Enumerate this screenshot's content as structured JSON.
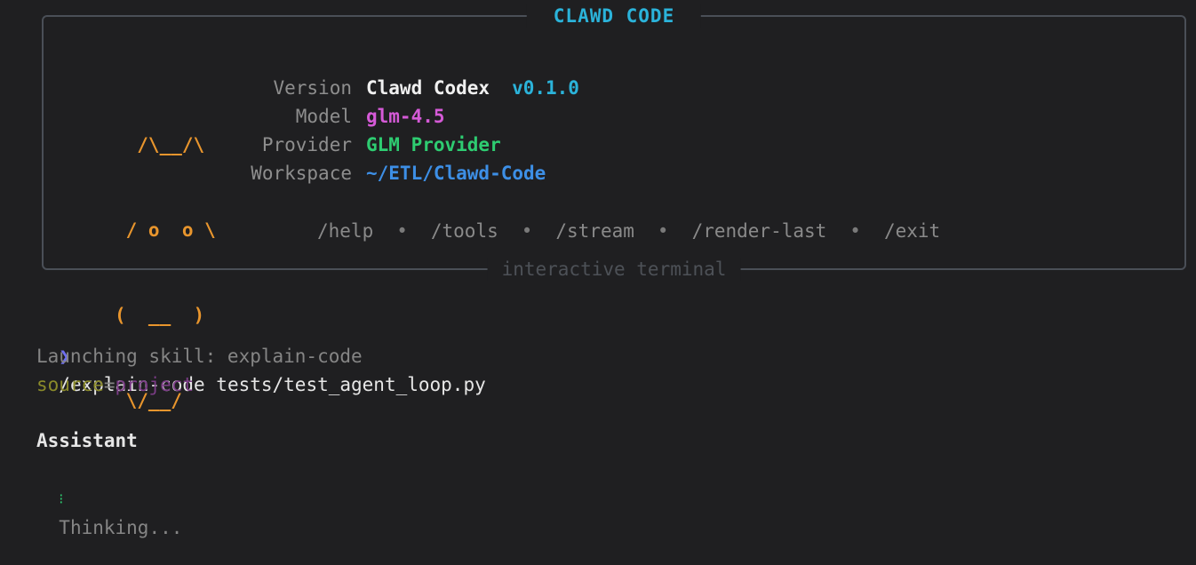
{
  "panel": {
    "title": "CLAWD CODE",
    "footer": "interactive terminal",
    "logo": {
      "lines": [
        "  /\\__/\\",
        " / o  o \\",
        "(  __  )",
        " \\/__/"
      ]
    },
    "info": {
      "version_label": "Version",
      "version_name": "Clawd Codex",
      "version_number": "v0.1.0",
      "model_label": "Model",
      "model_value": "glm-4.5",
      "provider_label": "Provider",
      "provider_value": "GLM Provider",
      "workspace_label": "Workspace",
      "workspace_value": "~/ETL/Clawd-Code"
    },
    "commands": [
      "/help",
      "/tools",
      "/stream",
      "/render-last",
      "/exit"
    ],
    "separator": "•"
  },
  "transcript": {
    "prompt_char": "❯",
    "command": "/explain-code tests/test_agent_loop.py",
    "launch_text": "Launching skill: explain-code",
    "source_key": "source",
    "source_eq": "=",
    "source_value": "project",
    "assistant_label": "Assistant",
    "spinner": "⁝",
    "thinking_text": "Thinking..."
  },
  "colors": {
    "background": "#1f1f21",
    "border": "#4a4f57",
    "title": "#2bb3da",
    "logo": "#e8952d",
    "model": "#d55ad7",
    "provider": "#2ecc71",
    "workspace": "#3d8fe6",
    "prompt": "#6f6ff0"
  }
}
